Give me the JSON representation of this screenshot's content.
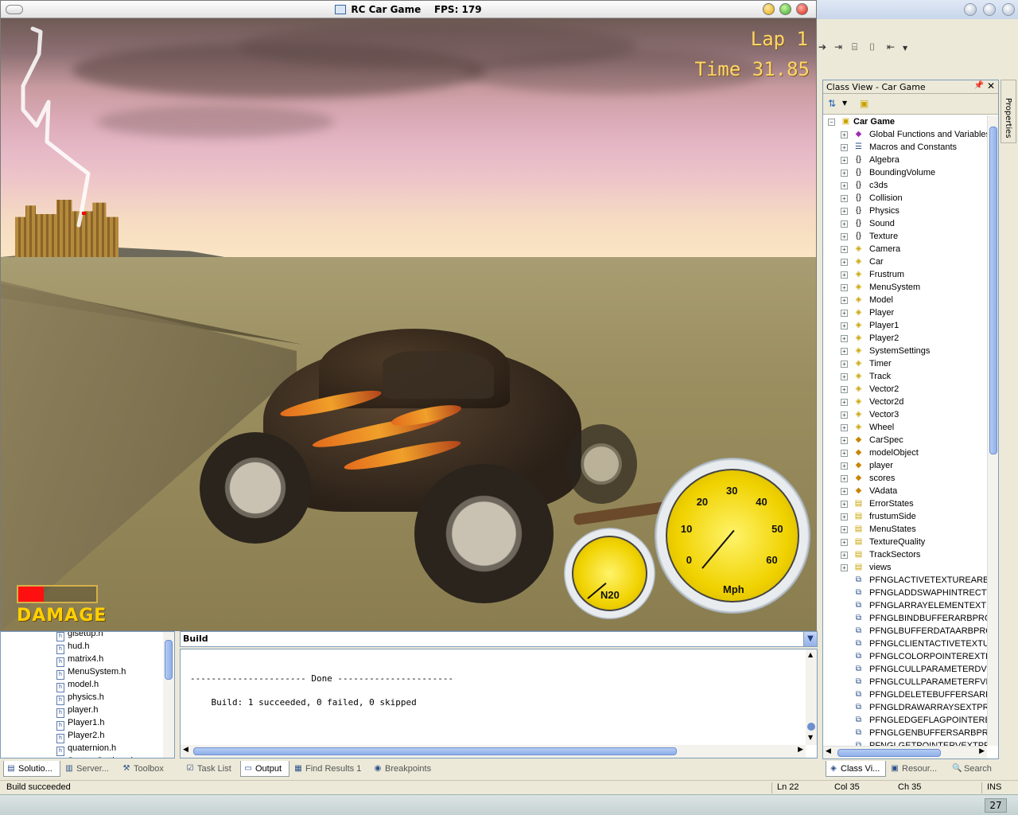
{
  "game": {
    "window_title": "RC Car Game",
    "fps_label": "FPS: 179",
    "hud": {
      "lap": "Lap 1",
      "time": "Time 31.85",
      "damage_label": "DAMAGE",
      "damage_level_percent": 33
    },
    "speedometer": {
      "unit": "Mph",
      "ticks": [
        "0",
        "10",
        "20",
        "30",
        "40",
        "50",
        "60"
      ],
      "needle_value": 3
    },
    "n2o_gauge": {
      "label": "N20",
      "needle_level_percent": 20
    }
  },
  "class_view": {
    "title": "Class View - Car Game",
    "root": "Car Game",
    "items": [
      {
        "label": "Global Functions and Variables",
        "icon": "globals-icon",
        "expander": "+"
      },
      {
        "label": "Macros and Constants",
        "icon": "macros-icon",
        "expander": "+"
      },
      {
        "label": "Algebra",
        "icon": "namespace-icon",
        "expander": "+"
      },
      {
        "label": "BoundingVolume",
        "icon": "namespace-icon",
        "expander": "+"
      },
      {
        "label": "c3ds",
        "icon": "namespace-icon",
        "expander": "+"
      },
      {
        "label": "Collision",
        "icon": "namespace-icon",
        "expander": "+"
      },
      {
        "label": "Physics",
        "icon": "namespace-icon",
        "expander": "+"
      },
      {
        "label": "Sound",
        "icon": "namespace-icon",
        "expander": "+"
      },
      {
        "label": "Texture",
        "icon": "namespace-icon",
        "expander": "+"
      },
      {
        "label": "Camera",
        "icon": "class-icon",
        "expander": "+"
      },
      {
        "label": "Car",
        "icon": "class-icon",
        "expander": "+"
      },
      {
        "label": "Frustrum",
        "icon": "class-icon",
        "expander": "+"
      },
      {
        "label": "MenuSystem",
        "icon": "class-icon",
        "expander": "+"
      },
      {
        "label": "Model",
        "icon": "class-icon",
        "expander": "+"
      },
      {
        "label": "Player",
        "icon": "class-icon",
        "expander": "+"
      },
      {
        "label": "Player1",
        "icon": "class-icon",
        "expander": "+"
      },
      {
        "label": "Player2",
        "icon": "class-icon",
        "expander": "+"
      },
      {
        "label": "SystemSettings",
        "icon": "class-icon",
        "expander": "+"
      },
      {
        "label": "Timer",
        "icon": "class-icon",
        "expander": "+"
      },
      {
        "label": "Track",
        "icon": "class-icon",
        "expander": "+"
      },
      {
        "label": "Vector2",
        "icon": "class-icon",
        "expander": "+"
      },
      {
        "label": "Vector2d",
        "icon": "class-icon",
        "expander": "+"
      },
      {
        "label": "Vector3",
        "icon": "class-icon",
        "expander": "+"
      },
      {
        "label": "Wheel",
        "icon": "class-icon",
        "expander": "+"
      },
      {
        "label": "CarSpec",
        "icon": "struct-icon",
        "expander": "+"
      },
      {
        "label": "modelObject",
        "icon": "struct-icon",
        "expander": "+"
      },
      {
        "label": "player",
        "icon": "struct-icon",
        "expander": "+"
      },
      {
        "label": "scores",
        "icon": "struct-icon",
        "expander": "+"
      },
      {
        "label": "VAdata",
        "icon": "struct-icon",
        "expander": "+"
      },
      {
        "label": "ErrorStates",
        "icon": "enum-icon",
        "expander": "+"
      },
      {
        "label": "frustumSide",
        "icon": "enum-icon",
        "expander": "+"
      },
      {
        "label": "MenuStates",
        "icon": "enum-icon",
        "expander": "+"
      },
      {
        "label": "TextureQuality",
        "icon": "enum-icon",
        "expander": "+"
      },
      {
        "label": "TrackSectors",
        "icon": "enum-icon",
        "expander": "+"
      },
      {
        "label": "views",
        "icon": "enum-icon",
        "expander": "+"
      },
      {
        "label": "PFNGLACTIVETEXTUREARBPROC",
        "icon": "typedef-icon",
        "expander": ""
      },
      {
        "label": "PFNGLADDSWAPHINTRECTWI",
        "icon": "typedef-icon",
        "expander": ""
      },
      {
        "label": "PFNGLARRAYELEMENTEXTPROC",
        "icon": "typedef-icon",
        "expander": ""
      },
      {
        "label": "PFNGLBINDBUFFERARBPROC",
        "icon": "typedef-icon",
        "expander": ""
      },
      {
        "label": "PFNGLBUFFERDATAARBPROC",
        "icon": "typedef-icon",
        "expander": ""
      },
      {
        "label": "PFNGLCLIENTACTIVETEXTURE",
        "icon": "typedef-icon",
        "expander": ""
      },
      {
        "label": "PFNGLCOLORPOINTEREXTPROC",
        "icon": "typedef-icon",
        "expander": ""
      },
      {
        "label": "PFNGLCULLPARAMETERDVEXT",
        "icon": "typedef-icon",
        "expander": ""
      },
      {
        "label": "PFNGLCULLPARAMETERFVEXT",
        "icon": "typedef-icon",
        "expander": ""
      },
      {
        "label": "PFNGLDELETEBUFFERSARBPRO",
        "icon": "typedef-icon",
        "expander": ""
      },
      {
        "label": "PFNGLDRAWARRAYSEXTPROC",
        "icon": "typedef-icon",
        "expander": ""
      },
      {
        "label": "PFNGLEDGEFLAGPOINTEREXT",
        "icon": "typedef-icon",
        "expander": ""
      },
      {
        "label": "PFNGLGENBUFFERSARBPROC",
        "icon": "typedef-icon",
        "expander": ""
      },
      {
        "label": "PFNGLGETPOINTERVEXTPROC",
        "icon": "typedef-icon",
        "expander": ""
      }
    ],
    "side_tab": "Properties"
  },
  "solution": {
    "files": [
      "glsetup.h",
      "hud.h",
      "matrix4.h",
      "MenuSystem.h",
      "model.h",
      "physics.h",
      "player.h",
      "Player1.h",
      "Player2.h",
      "quaternion.h",
      "SystemSettings.h"
    ]
  },
  "output": {
    "source": "Build",
    "lines": [
      "---------------------- Done ----------------------",
      "    Build: 1 succeeded, 0 failed, 0 skipped"
    ]
  },
  "tabs_left": [
    {
      "label": "Solutio...",
      "icon": "solution-icon",
      "active": true
    },
    {
      "label": "Server...",
      "icon": "server-icon",
      "active": false
    },
    {
      "label": "Toolbox",
      "icon": "toolbox-icon",
      "active": false
    }
  ],
  "tabs_middle": [
    {
      "label": "Task List",
      "icon": "tasklist-icon",
      "active": false
    },
    {
      "label": "Output",
      "icon": "output-icon",
      "active": true
    },
    {
      "label": "Find Results 1",
      "icon": "find-icon",
      "active": false
    },
    {
      "label": "Breakpoints",
      "icon": "breakpoint-icon",
      "active": false
    }
  ],
  "tabs_right": [
    {
      "label": "Class Vi...",
      "icon": "classview-icon",
      "active": true
    },
    {
      "label": "Resour...",
      "icon": "resource-icon",
      "active": false
    },
    {
      "label": "Search",
      "icon": "search-icon",
      "active": false
    }
  ],
  "statusbar": {
    "message": "Build succeeded",
    "line": "Ln 22",
    "col": "Col 35",
    "ch": "Ch 35",
    "mode": "INS"
  },
  "taskbar": {
    "clock": "27"
  },
  "colors": {
    "hud_text": "#ffd56a",
    "damage_fill": "#ff1010",
    "gauge_yellow": "#f0d200",
    "selection_blue": "#316ac5"
  }
}
